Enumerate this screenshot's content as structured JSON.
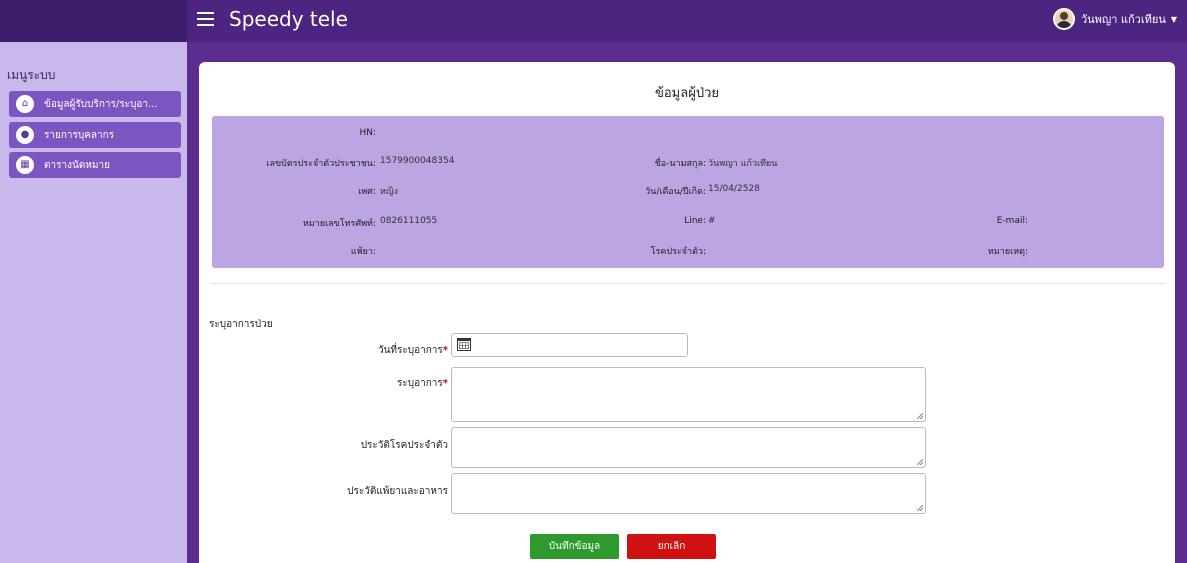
{
  "header": {
    "app_title": "Speedy tele",
    "user_name": "วันพญา แก้วเทียน",
    "caret": "▼"
  },
  "sidebar": {
    "heading": "เมนูระบบ",
    "items": [
      {
        "label": "ข้อมูลผู้รับบริการ/ระบุอา...",
        "icon": "home-icon"
      },
      {
        "label": "รายการบุคลากร",
        "icon": "staff-icon"
      },
      {
        "label": "ตารางนัดหมาย",
        "icon": "table-icon"
      }
    ]
  },
  "card": {
    "title": "ข้อมูลผู้ป่วย"
  },
  "patient": {
    "hn_label": "HN:",
    "hn_value": "",
    "id_label": "เลขบัตรประจำตัวประชาชน:",
    "id_value": "1579900048354",
    "name_label": "ชื่อ-นามสกุล:",
    "name_value": "วันพญา แก้วเทียน",
    "sex_label": "เพศ:",
    "sex_value": "หญิง",
    "dob_label": "วัน/เดือน/ปีเกิด:",
    "dob_value": "15/04/2528",
    "phone_label": "หมายเลขโทรศัพท์:",
    "phone_value": "0826111055",
    "line_label": "Line:",
    "line_value": "#",
    "email_label": "E-mail:",
    "email_value": "",
    "allergy_label": "แพ้ยา:",
    "allergy_value": "",
    "disease_label": "โรคประจำตัว:",
    "disease_value": "",
    "note_label": "หมายเหตุ:",
    "note_value": ""
  },
  "form": {
    "section_title": "ระบุอาการป่วย",
    "date_label": "วันที่ระบุอาการ",
    "symptom_label": "ระบุอาการ",
    "history_label": "ประวัติโรคประจำตัว",
    "allergy_food_label": "ประวัติแพ้ยาและอาหาร",
    "required_mark": "*",
    "date_value": "",
    "symptom_value": "",
    "history_value": "",
    "allergy_food_value": ""
  },
  "buttons": {
    "save": "บันทึกข้อมูล",
    "cancel": "ยกเลิก"
  },
  "colors": {
    "navbar": "#4b2580",
    "sidebar": "#c9b8ec",
    "menu_item": "#7b55c0",
    "info_box": "#bca5e3",
    "save": "#2e9a2e",
    "cancel": "#d01111"
  }
}
